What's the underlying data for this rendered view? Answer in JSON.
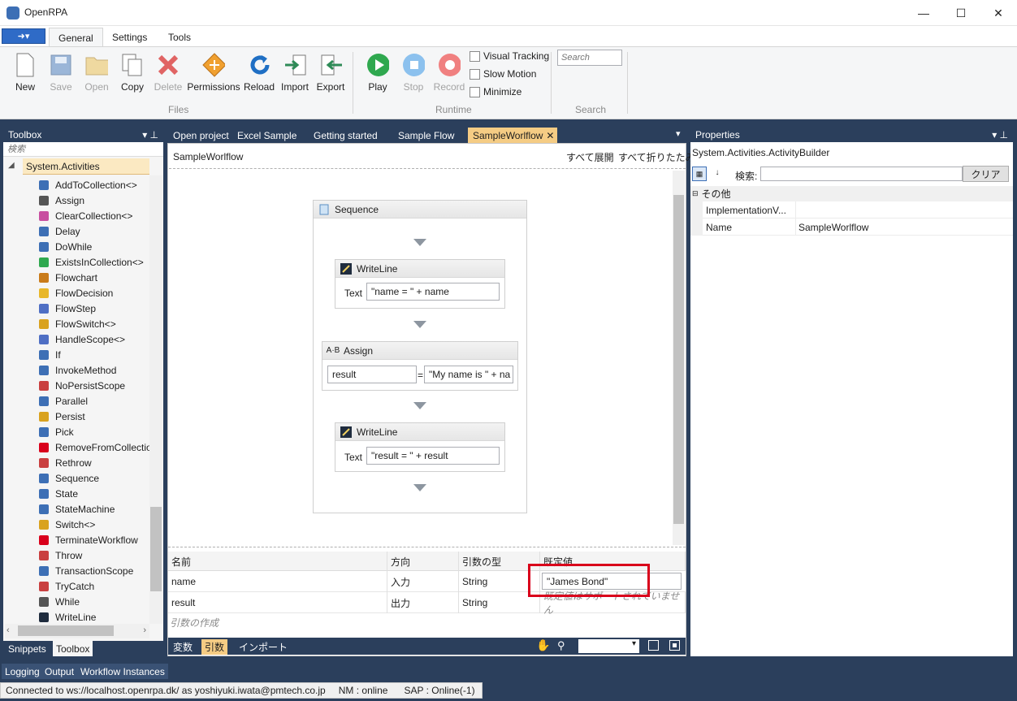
{
  "window": {
    "title": "OpenRPA",
    "minimize": "—",
    "maximize": "☐",
    "close": "✕"
  },
  "ribbon": {
    "tabs": [
      "General",
      "Settings",
      "Tools"
    ],
    "files": {
      "label": "Files",
      "buttons": [
        "New",
        "Save",
        "Open",
        "Copy",
        "Delete",
        "Permissions",
        "Reload",
        "Import",
        "Export"
      ]
    },
    "runtime": {
      "label": "Runtime",
      "buttons": [
        "Play",
        "Stop",
        "Record"
      ],
      "checks": [
        "Visual Tracking",
        "Slow Motion",
        "Minimize"
      ]
    },
    "search": {
      "label": "Search",
      "placeholder": "Search"
    }
  },
  "toolbox": {
    "title": "Toolbox",
    "search_placeholder": "検索",
    "category": "System.Activities",
    "items": [
      "AddToCollection<>",
      "Assign",
      "ClearCollection<>",
      "Delay",
      "DoWhile",
      "ExistsInCollection<>",
      "Flowchart",
      "FlowDecision",
      "FlowStep",
      "FlowSwitch<>",
      "HandleScope<>",
      "If",
      "InvokeMethod",
      "NoPersistScope",
      "Parallel",
      "Persist",
      "Pick",
      "RemoveFromCollectio",
      "Rethrow",
      "Sequence",
      "State",
      "StateMachine",
      "Switch<>",
      "TerminateWorkflow",
      "Throw",
      "TransactionScope",
      "TryCatch",
      "While",
      "WriteLine"
    ],
    "tabs": [
      "Snippets",
      "Toolbox"
    ]
  },
  "doc_tabs": [
    "Open project",
    "Excel Sample",
    "Getting started",
    "Sample Flow",
    "SampleWorlflow"
  ],
  "designer": {
    "breadcrumb": "SampleWorlflow",
    "expand_all": "すべて展開",
    "collapse_all": "すべて折りたたみ",
    "sequence_title": "Sequence",
    "writeline1": {
      "title": "WriteLine",
      "label": "Text",
      "value": "\"name = \" + name"
    },
    "assign": {
      "title": "Assign",
      "to": "result",
      "eq": "=",
      "value": "\"My name is \" + na"
    },
    "writeline2": {
      "title": "WriteLine",
      "label": "Text",
      "value": "\"result = \" + result"
    }
  },
  "args": {
    "headers": [
      "名前",
      "方向",
      "引数の型",
      "既定値"
    ],
    "rows": [
      {
        "name": "name",
        "direction": "入力",
        "type": "String",
        "default": "\"James Bond\""
      },
      {
        "name": "result",
        "direction": "出力",
        "type": "String",
        "default": "既定値はサポートされていません"
      }
    ],
    "create": "引数の作成",
    "bottom_tabs": [
      "変数",
      "引数",
      "インポート"
    ]
  },
  "properties": {
    "title": "Properties",
    "type": "System.Activities.ActivityBuilder",
    "search_label": "検索:",
    "clear": "クリア",
    "category": "その他",
    "rows": [
      {
        "name": "ImplementationV...",
        "value": ""
      },
      {
        "name": "Name",
        "value": "SampleWorlflow"
      }
    ]
  },
  "bottom_tabs": [
    "Logging",
    "Output",
    "Workflow Instances"
  ],
  "status": {
    "connection": "Connected to ws://localhost.openrpa.dk/ as yoshiyuki.iwata@pmtech.co.jp",
    "nm": "NM : online",
    "sap": "SAP : Online(-1)"
  },
  "colors": {
    "accent": "#f5cc84",
    "chrome": "#2b3f5c",
    "highlight": "#d9001b"
  }
}
